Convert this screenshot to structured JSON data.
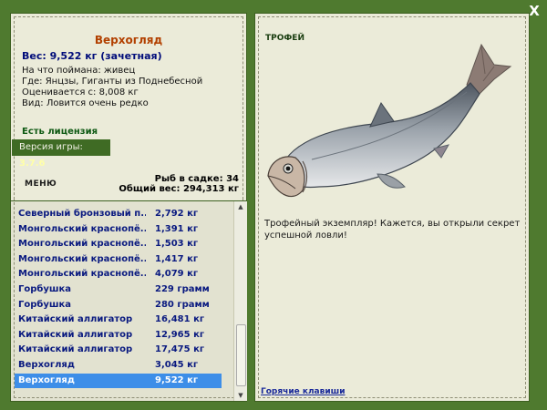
{
  "close_label": "X",
  "fish": {
    "title": "Верхогляд",
    "weight": "Вес: 9,522 кг (зачетная)",
    "caught_on": "На что поймана: живец",
    "location": "Где: Янцзы, Гиганты из Поднебесной",
    "value": "Оценивается с: 8,008 кг",
    "kind": "Вид: Ловится очень редко"
  },
  "license": "Есть лицензия",
  "version": {
    "label": "Версия игры:",
    "value": "3.7.6"
  },
  "menu_label": "МЕНЮ",
  "cage": {
    "count_line": "Рыб в садке: 34",
    "total_line": "Общий вес: 294,313 кг"
  },
  "catch_list": [
    {
      "name": "Северный бронзовый п...",
      "weight": "2,792 кг"
    },
    {
      "name": "Монгольский краснопё...",
      "weight": "1,391 кг"
    },
    {
      "name": "Монгольский краснопё...",
      "weight": "1,503 кг"
    },
    {
      "name": "Монгольский краснопё...",
      "weight": "1,417 кг"
    },
    {
      "name": "Монгольский краснопё...",
      "weight": "4,079 кг"
    },
    {
      "name": "Горбушка",
      "weight": "229 грамм"
    },
    {
      "name": "Горбушка",
      "weight": "280 грамм"
    },
    {
      "name": "Китайский аллигатор",
      "weight": "16,481 кг"
    },
    {
      "name": "Китайский аллигатор",
      "weight": "12,965 кг"
    },
    {
      "name": "Китайский аллигатор",
      "weight": "17,475 кг"
    },
    {
      "name": "Верхогляд",
      "weight": "3,045 кг"
    },
    {
      "name": "Верхогляд",
      "weight": "9,522 кг",
      "selected": true
    }
  ],
  "trophy": {
    "label": "ТРОФЕЙ",
    "text": "Трофейный экземпляр! Кажется, вы открыли секрет успешной ловли!"
  },
  "hotkeys": "Горячие клавиши",
  "colors": {
    "background": "#4f7a2f",
    "panel": "#ebebd9",
    "title": "#b24000",
    "selection": "#3d8ee8"
  }
}
